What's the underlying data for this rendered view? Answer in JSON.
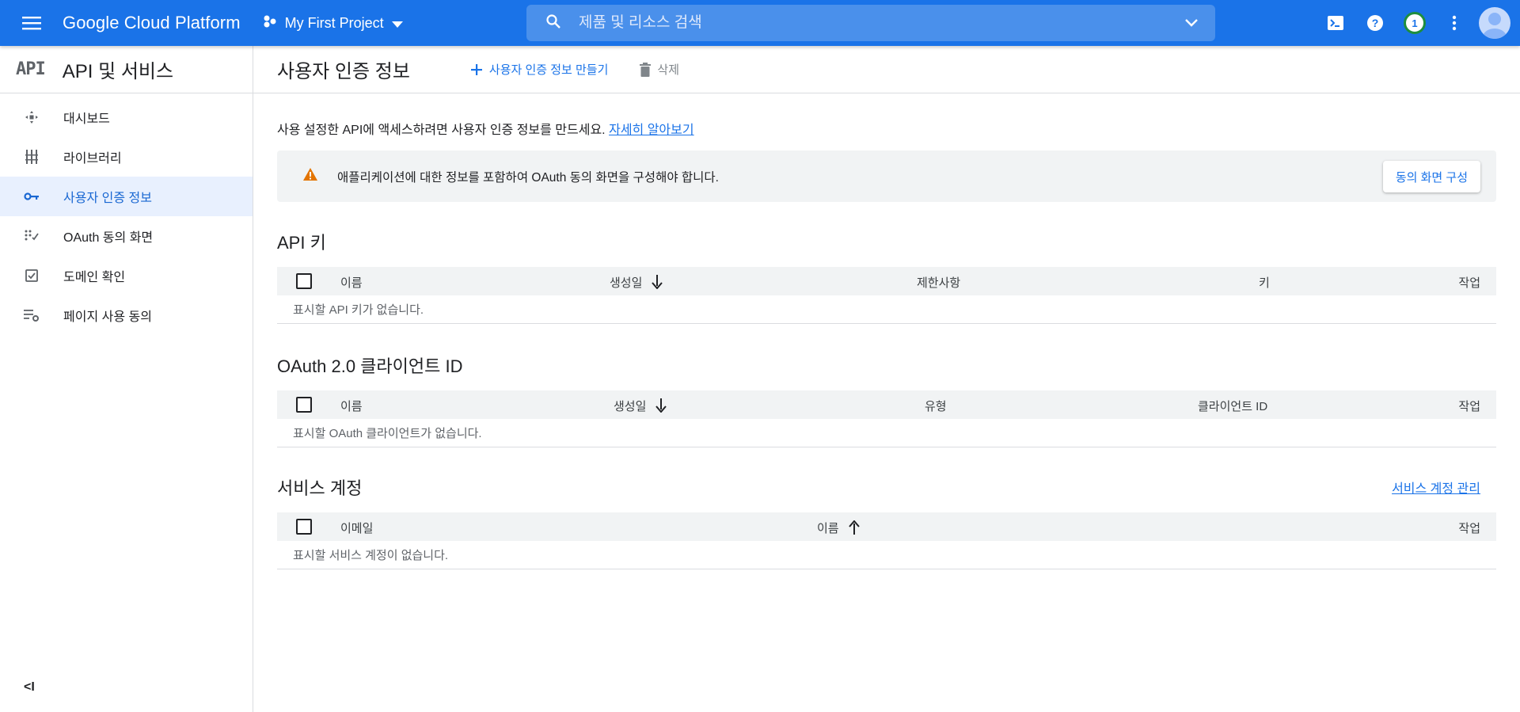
{
  "topbar": {
    "brand": "Google Cloud Platform",
    "project": "My First Project",
    "search_placeholder": "제품 및 리소스 검색",
    "notification_count": "1",
    "colors": {
      "bar": "#1a73e8",
      "search": "#4a90eb"
    }
  },
  "sidebar": {
    "logo": "API",
    "title": "API 및 서비스",
    "items": [
      {
        "label": "대시보드",
        "icon": "dashboard-icon",
        "active": false
      },
      {
        "label": "라이브러리",
        "icon": "library-icon",
        "active": false
      },
      {
        "label": "사용자 인증 정보",
        "icon": "key-icon",
        "active": true
      },
      {
        "label": "OAuth 동의 화면",
        "icon": "oauth-icon",
        "active": false
      },
      {
        "label": "도메인 확인",
        "icon": "checkbox-icon",
        "active": false
      },
      {
        "label": "페이지 사용 동의",
        "icon": "settings-list-icon",
        "active": false
      }
    ],
    "collapse": "<I"
  },
  "header": {
    "title": "사용자 인증 정보",
    "create_label": "사용자 인증 정보 만들기",
    "delete_label": "삭제"
  },
  "intro": {
    "text": "사용 설정한 API에 액세스하려면 사용자 인증 정보를 만드세요.",
    "link": "자세히 알아보기"
  },
  "banner": {
    "text": "애플리케이션에 대한 정보를 포함하여 OAuth 동의 화면을 구성해야 합니다.",
    "button": "동의 화면 구성"
  },
  "api_keys": {
    "title": "API 키",
    "columns": [
      "이름",
      "생성일",
      "제한사항",
      "키",
      "작업"
    ],
    "empty": "표시할 API 키가 없습니다."
  },
  "oauth": {
    "title": "OAuth 2.0 클라이언트 ID",
    "columns": [
      "이름",
      "생성일",
      "유형",
      "클라이언트 ID",
      "작업"
    ],
    "empty": "표시할 OAuth 클라이언트가 없습니다."
  },
  "service_accounts": {
    "title": "서비스 계정",
    "manage_link": "서비스 계정 관리",
    "columns": [
      "이메일",
      "이름",
      "작업"
    ],
    "empty": "표시할 서비스 계정이 없습니다."
  }
}
